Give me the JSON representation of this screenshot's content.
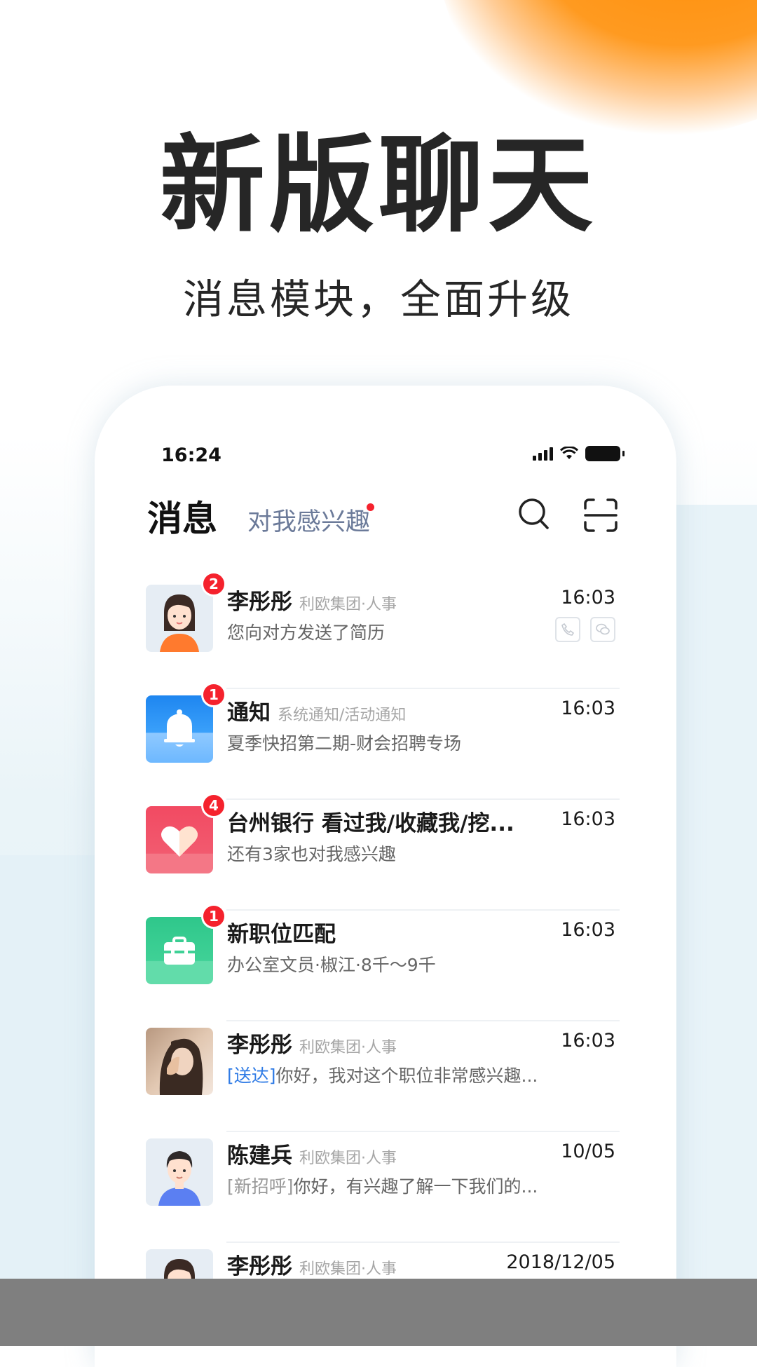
{
  "hero": {
    "title": "新版聊天",
    "subtitle": "消息模块，全面升级"
  },
  "status_bar": {
    "time": "16:24",
    "icons": [
      "signal-icon",
      "wifi-icon",
      "battery-icon"
    ]
  },
  "header": {
    "title": "消息",
    "tab_label": "对我感兴趣",
    "tab_has_red_dot": true,
    "search_icon": "search-icon",
    "scan_icon": "scan-icon"
  },
  "colors": {
    "accent_orange": "#ff8a00",
    "badge_red": "#f5222d",
    "link_blue": "#2f7be5",
    "notify_blue": "#2a8ef5",
    "heart_red": "#f2536b",
    "job_green": "#3ccf8e"
  },
  "messages": [
    {
      "name": "李彤彤",
      "org": "利欧集团·人事",
      "time": "16:03",
      "preview": "您向对方发送了简历",
      "badge": "2",
      "avatar": "female-avatar"
    },
    {
      "name": "通知",
      "org": "系统通知/活动通知",
      "time": "16:03",
      "preview": "夏季快招第二期-财会招聘专场",
      "badge": "1",
      "avatar": "bell-icon"
    },
    {
      "name": "台州银行 看过我/收藏我/挖...",
      "org": "",
      "time": "16:03",
      "preview": "还有3家也对我感兴趣",
      "badge": "4",
      "avatar": "heart-icon"
    },
    {
      "name": "新职位匹配",
      "org": "",
      "time": "16:03",
      "preview": "办公室文员·椒江·8千～9千",
      "badge": "1",
      "avatar": "briefcase-icon"
    },
    {
      "name": "李彤彤",
      "org": "利欧集团·人事",
      "time": "16:03",
      "preview_tag": "[送达]",
      "preview": "你好，我对这个职位非常感兴趣...",
      "badge": "",
      "avatar": "photo-avatar"
    },
    {
      "name": "陈建兵",
      "org": "利欧集团·人事",
      "time": "10/05",
      "preview_tag": "[新招呼]",
      "preview": "你好，有兴趣了解一下我们的...",
      "badge": "",
      "avatar": "male-avatar"
    },
    {
      "name": "李彤彤",
      "org": "利欧集团·人事",
      "time": "2018/12/05",
      "preview": "",
      "badge": "",
      "avatar": "female-avatar"
    }
  ]
}
